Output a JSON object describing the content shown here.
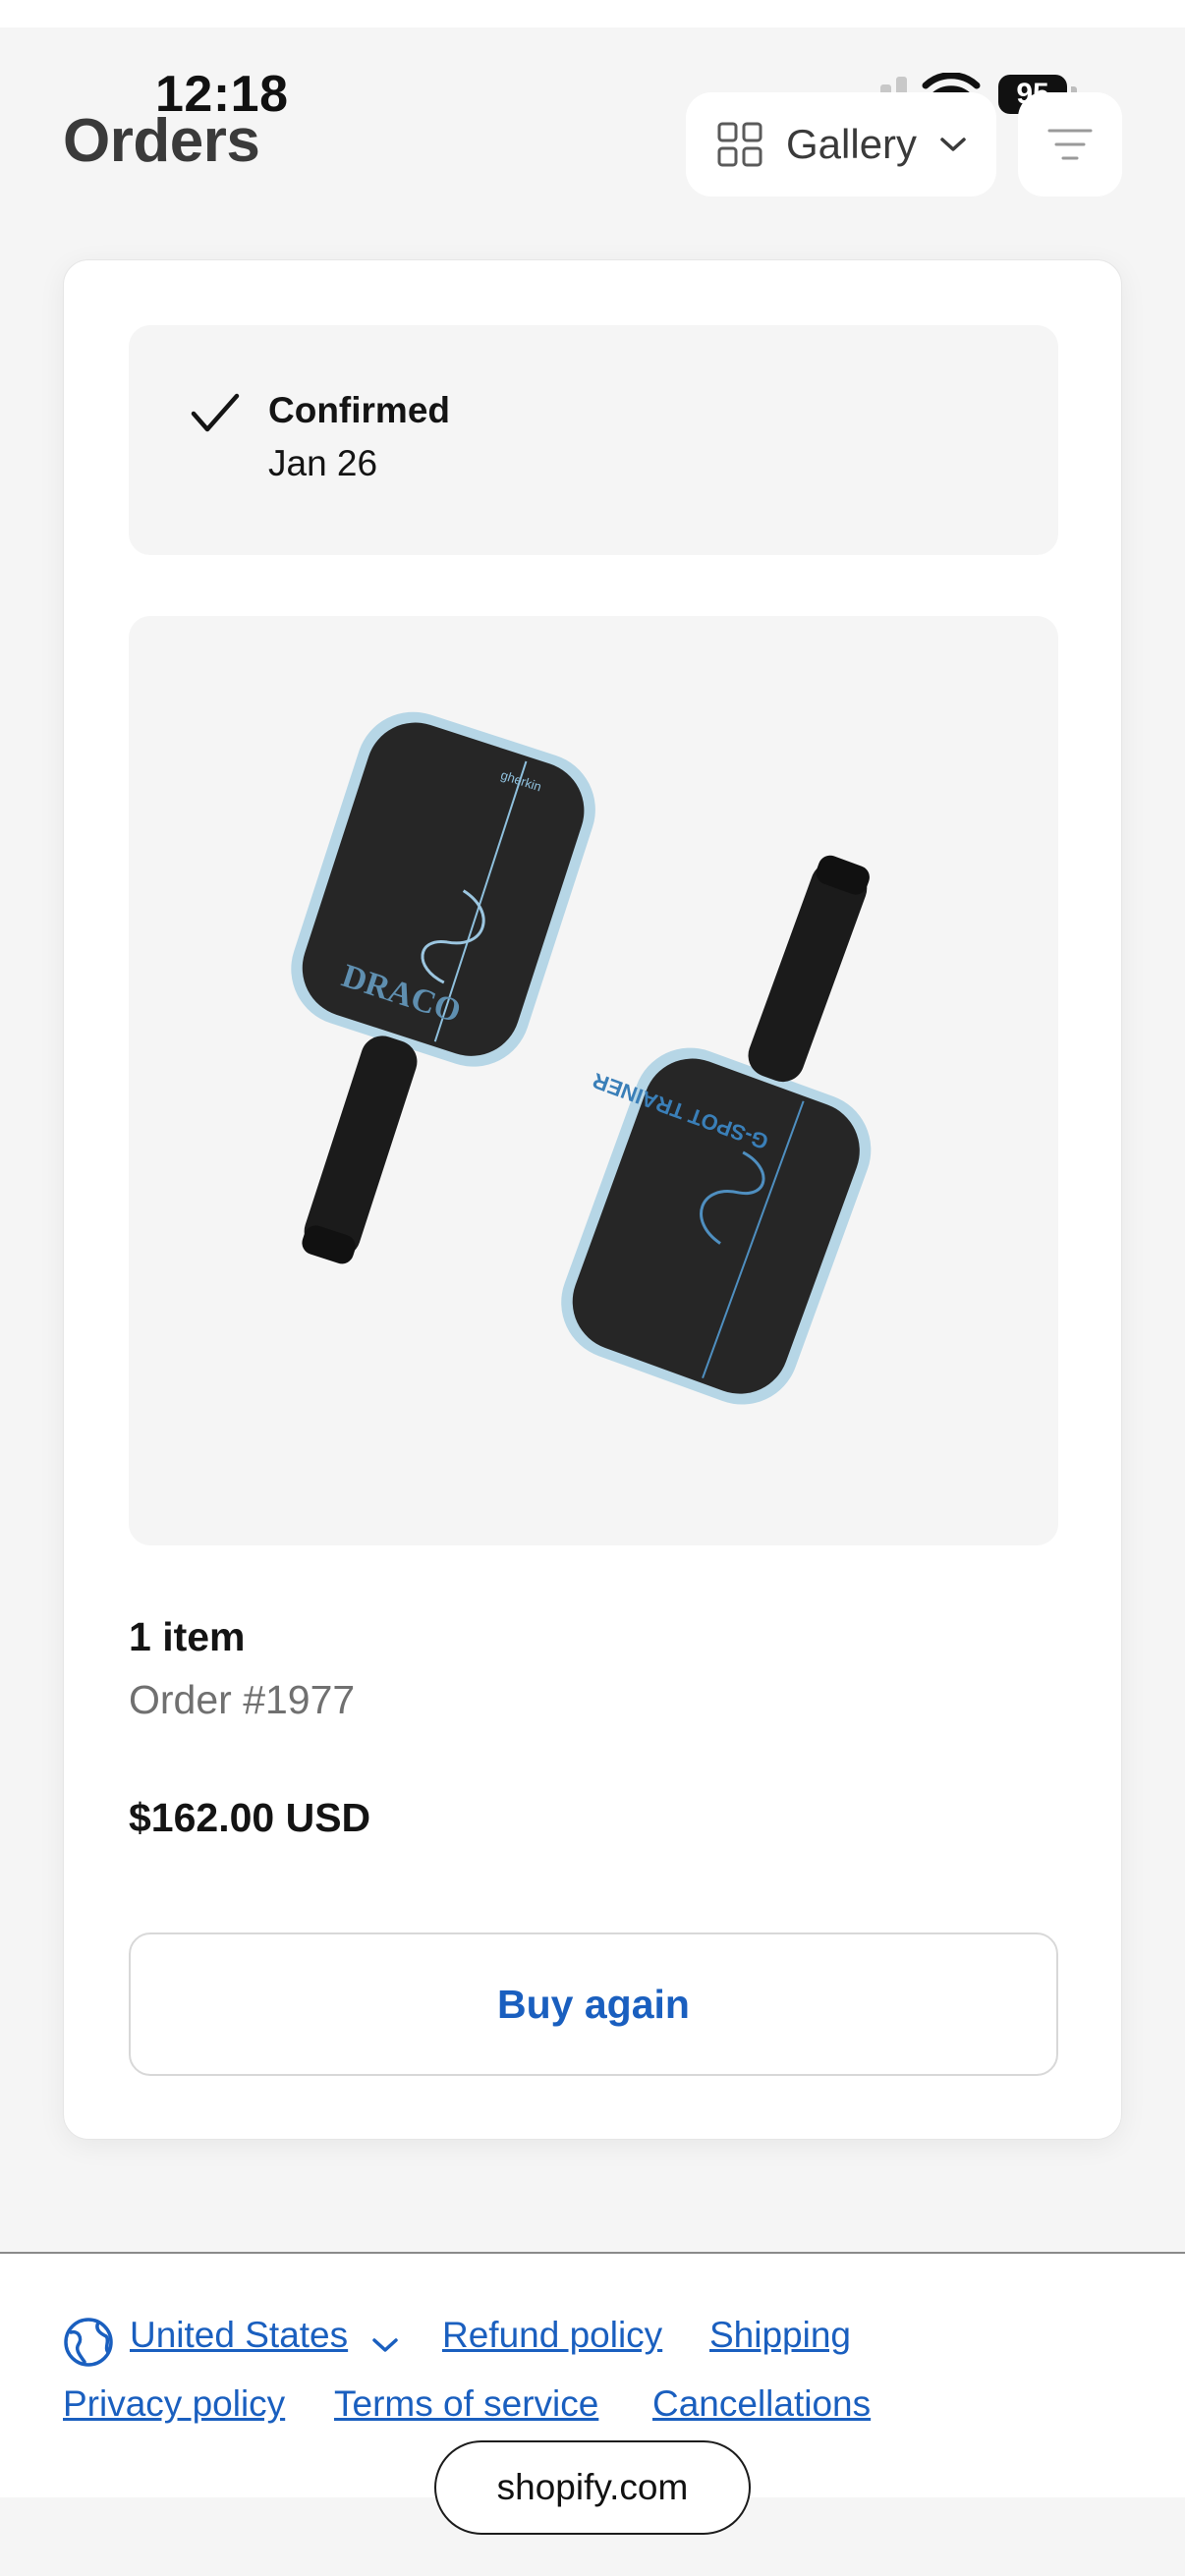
{
  "status_bar": {
    "time": "12:18",
    "battery": "95"
  },
  "header": {
    "title": "Orders",
    "view_select": {
      "icon": "grid-icon",
      "label": "Gallery"
    },
    "filter_icon": "filter-lines-icon"
  },
  "order": {
    "status": {
      "icon": "check-icon",
      "title": "Confirmed",
      "date": "Jan 26"
    },
    "image": {
      "description_icon": "pickleball-paddles-image",
      "paddle_brand": "gherkin",
      "paddle_1_text": "DRACO",
      "paddle_2_text": "G-SPOT TRAINER"
    },
    "item_count": "1 item",
    "order_number": "Order #1977",
    "total": "$162.00 USD",
    "buy_again_label": "Buy again"
  },
  "footer": {
    "region_icon": "globe-icon",
    "region": "United States",
    "links": {
      "refund": "Refund policy",
      "shipping": "Shipping",
      "privacy": "Privacy policy",
      "terms": "Terms of service",
      "cancellations": "Cancellations"
    }
  },
  "browser": {
    "url": "shopify.com"
  },
  "colors": {
    "link": "#1a5fbf",
    "background": "#f5f5f5",
    "card": "#ffffff"
  }
}
